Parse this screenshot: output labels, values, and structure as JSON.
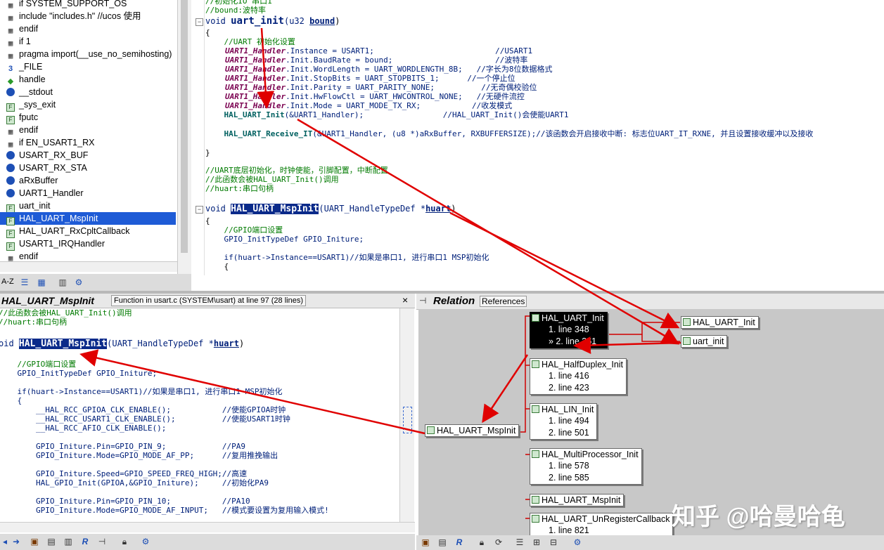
{
  "symbols": [
    {
      "label": "if SYSTEM_SUPPORT_OS",
      "icon": "hash-icon"
    },
    {
      "label": "include \"includes.h\" //ucos 使用",
      "icon": "hash-icon"
    },
    {
      "label": "endif",
      "icon": "hash-icon"
    },
    {
      "label": "if 1",
      "icon": "hash-icon"
    },
    {
      "label": "pragma import(__use_no_semihosting)",
      "icon": "hash-icon"
    },
    {
      "label": "_FILE",
      "icon": "macro-icon"
    },
    {
      "label": "handle",
      "icon": "handle-icon"
    },
    {
      "label": "__stdout",
      "icon": "variable-icon"
    },
    {
      "label": "_sys_exit",
      "icon": "function-icon"
    },
    {
      "label": "fputc",
      "icon": "function-icon"
    },
    {
      "label": "endif",
      "icon": "hash-icon"
    },
    {
      "label": "if EN_USART1_RX",
      "icon": "hash-icon"
    },
    {
      "label": "USART_RX_BUF",
      "icon": "variable-icon"
    },
    {
      "label": "USART_RX_STA",
      "icon": "variable-icon"
    },
    {
      "label": "aRxBuffer",
      "icon": "variable-icon"
    },
    {
      "label": "UART1_Handler",
      "icon": "variable-icon"
    },
    {
      "label": "uart_init",
      "icon": "function-icon"
    },
    {
      "label": "HAL_UART_MspInit",
      "icon": "function-icon",
      "selected": true
    },
    {
      "label": "HAL_UART_RxCpltCallback",
      "icon": "function-icon"
    },
    {
      "label": "USART1_IRQHandler",
      "icon": "function-icon"
    },
    {
      "label": "endif",
      "icon": "hash-icon"
    }
  ],
  "symbol_toolbar": {
    "az": "A-Z"
  },
  "code": {
    "l0": "//初始化IO 串口1",
    "l1": "//bound:波特率",
    "l2_void": "void ",
    "l2_fn": "uart_init",
    "l2_args": "(u32 ",
    "l2_param": "bound",
    "l2_close": ")",
    "l3": "{",
    "l4": "    //UART 初始化设置",
    "l5_a": "    UART1_Handler",
    ".l5_b": "",
    "l5": ".Instance = USART1;                          //USART1",
    "l6": ".Init.BaudRate = bound;                      //波特率",
    "l7": ".Init.WordLength = UART_WORDLENGTH_8B;   //字长为8位数据格式",
    "l8": ".Init.StopBits = UART_STOPBITS_1;      //一个停止位",
    "l9": ".Init.Parity = UART_PARITY_NONE;          //无奇偶校验位",
    "l10": ".Init.HwFlowCtl = UART_HWCONTROL_NONE;   //无硬件流控",
    "l11": ".Init.Mode = UART_MODE_TX_RX;           //收发模式",
    "handler": "UART1_Handler",
    "l12_fn": "    HAL_UART_Init",
    "l12_rest": "(&UART1_Handler);                 //HAL_UART_Init()会使能UART1",
    "l13_fn": "    HAL_UART_Receive_IT",
    "l13_rest": "(&UART1_Handler, (u8 *)aRxBuffer, RXBUFFERSIZE);//该函数会开启接收中断: 标志位UART_IT_RXNE, 并且设置接收缓冲以及接收",
    "l14": "}",
    "l15": "//UART底层初始化，时钟使能，引脚配置，中断配置",
    "l16": "//此函数会被HAL_UART_Init()调用",
    "l17": "//huart:串口句柄",
    "l18_void": "void ",
    "l18_fn": "HAL_UART_MspInit",
    "l18_args": "(UART_HandleTypeDef *",
    "l18_param": "huart",
    "l18_close": ")",
    "l19": "{",
    "l20": "    //GPIO端口设置",
    "l21": "    GPIO_InitTypeDef GPIO_Initure;",
    "l22": "    if(huart->Instance==USART1)//如果是串口1, 进行串口1 MSP初始化",
    "l23": "    {"
  },
  "context": {
    "title": "HAL_UART_MspInit",
    "info": "Function in usart.c (SYSTEM\\usart) at line 97 (28 lines)",
    "close": "×",
    "lines": [
      "//此函数会被HAL_UART_Init()调用",
      "//huart:串口句柄",
      "",
      "",
      "    //GPIO端口设置",
      "    GPIO_InitTypeDef GPIO_Initure;",
      "",
      "    if(huart->Instance==USART1)//如果是串口1, 进行串口1 MSP初始化",
      "    {",
      "        __HAL_RCC_GPIOA_CLK_ENABLE();           //使能GPIOA时钟",
      "        __HAL_RCC_USART1_CLK_ENABLE();          //使能USART1时钟",
      "        __HAL_RCC_AFIO_CLK_ENABLE();",
      "",
      "        GPIO_Initure.Pin=GPIO_PIN_9;            //PA9",
      "        GPIO_Initure.Mode=GPIO_MODE_AF_PP;      //复用推挽输出",
      "",
      "        GPIO_Initure.Speed=GPIO_SPEED_FREQ_HIGH;//高速",
      "        HAL_GPIO_Init(GPIOA,&GPIO_Initure);     //初始化PA9",
      "",
      "        GPIO_Initure.Pin=GPIO_PIN_10;           //PA10",
      "        GPIO_Initure.Mode=GPIO_MODE_AF_INPUT;   //模式要设置为复用输入模式!"
    ],
    "sig_void": "oid ",
    "sig_fn": "HAL_UART_MspInit",
    "sig_args": "(UART_HandleTypeDef *",
    "sig_param": "huart",
    "sig_close": ")"
  },
  "relation": {
    "title": "Relation",
    "tab": "References",
    "root": "HAL_UART_MspInit",
    "right_top": "HAL_UART_Init",
    "right_bottom": "uart_init",
    "nodes": [
      {
        "name": "HAL_UART_Init",
        "lines": [
          "1. line 348",
          "» 2. line 361"
        ],
        "dark": true
      },
      {
        "name": "HAL_HalfDuplex_Init",
        "lines": [
          "1. line 416",
          "2. line 423"
        ]
      },
      {
        "name": "HAL_LIN_Init",
        "lines": [
          "1. line 494",
          "2. line 501"
        ]
      },
      {
        "name": "HAL_MultiProcessor_Init",
        "lines": [
          "1. line 578",
          "2. line 585"
        ]
      },
      {
        "name": "HAL_UART_MspInit",
        "lines": []
      },
      {
        "name": "HAL_UART_UnRegisterCallback",
        "lines": [
          "1. line 821"
        ]
      }
    ]
  },
  "watermark": "知乎 @哈曼哈龟",
  "colors": {
    "selection": "#1e5bd6",
    "arrow": "#e00000",
    "highlight": "#0a2a8a"
  }
}
